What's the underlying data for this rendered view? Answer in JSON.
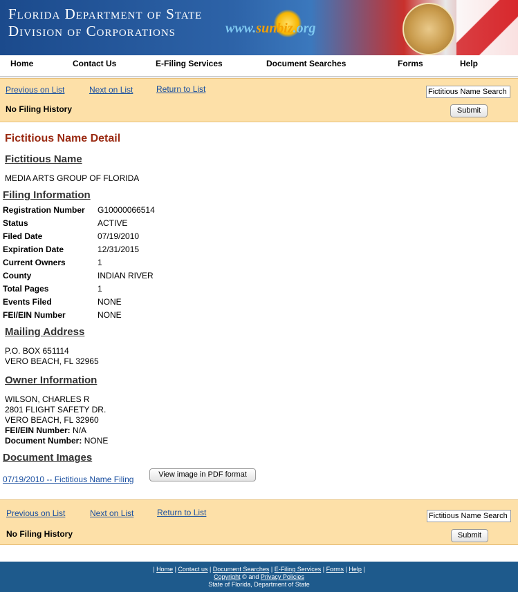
{
  "banner": {
    "line1": "Florida Department of State",
    "line2": "Division of Corporations",
    "logo_pre": "www.",
    "logo_mid": "sunbiz",
    "logo_post": ".org",
    "seal_icon": "florida-seal-icon"
  },
  "nav": {
    "items": [
      "Home",
      "Contact Us",
      "E-Filing Services",
      "Document Searches",
      "Forms",
      "Help"
    ]
  },
  "top_band": {
    "prev": "Previous on List",
    "next": "Next on List",
    "return": "Return to List",
    "no_filing": "No Filing History",
    "search_value": "Fictitious Name Search",
    "submit": "Submit"
  },
  "detail": {
    "title": "Fictitious Name Detail",
    "fictitious_heading": "Fictitious Name",
    "fictitious_name": "MEDIA ARTS GROUP OF FLORIDA",
    "filing_heading": "Filing Information",
    "rows": [
      {
        "label": "Registration Number",
        "value": "G10000066514"
      },
      {
        "label": "Status",
        "value": "ACTIVE"
      },
      {
        "label": "Filed Date",
        "value": "07/19/2010"
      },
      {
        "label": "Expiration Date",
        "value": "12/31/2015"
      },
      {
        "label": "Current Owners",
        "value": "1"
      },
      {
        "label": "County",
        "value": "INDIAN RIVER"
      },
      {
        "label": "Total Pages",
        "value": "1"
      },
      {
        "label": "Events Filed",
        "value": "NONE"
      },
      {
        "label": "FEI/EIN Number",
        "value": "NONE"
      }
    ],
    "mailing_heading": "Mailing Address",
    "mailing": [
      "P.O. BOX 651114",
      "VERO BEACH, FL 32965"
    ],
    "owner_heading": "Owner Information",
    "owner": [
      "WILSON, CHARLES R",
      "2801 FLIGHT SAFETY DR.",
      "VERO BEACH, FL 32960"
    ],
    "owner_fei_label": "FEI/EIN Number:",
    "owner_fei_value": "N/A",
    "owner_doc_label": "Document Number:",
    "owner_doc_value": "NONE",
    "images_heading": "Document Images",
    "image_link": "07/19/2010 -- Fictitious Name Filing",
    "pdf_button": "View image in PDF format"
  },
  "bottom_band": {
    "prev": "Previous on List",
    "next": "Next on List",
    "return": "Return to List",
    "no_filing": "No Filing History",
    "search_value": "Fictitious Name Search",
    "submit": "Submit"
  },
  "footer": {
    "links": [
      "Home",
      "Contact us",
      "Document Searches",
      "E-Filing Services",
      "Forms",
      "Help"
    ],
    "copyright": "Copyright",
    "copy_symbol": "©",
    "and": "and",
    "privacy": "Privacy Policies",
    "state": "State of Florida, Department of State"
  }
}
